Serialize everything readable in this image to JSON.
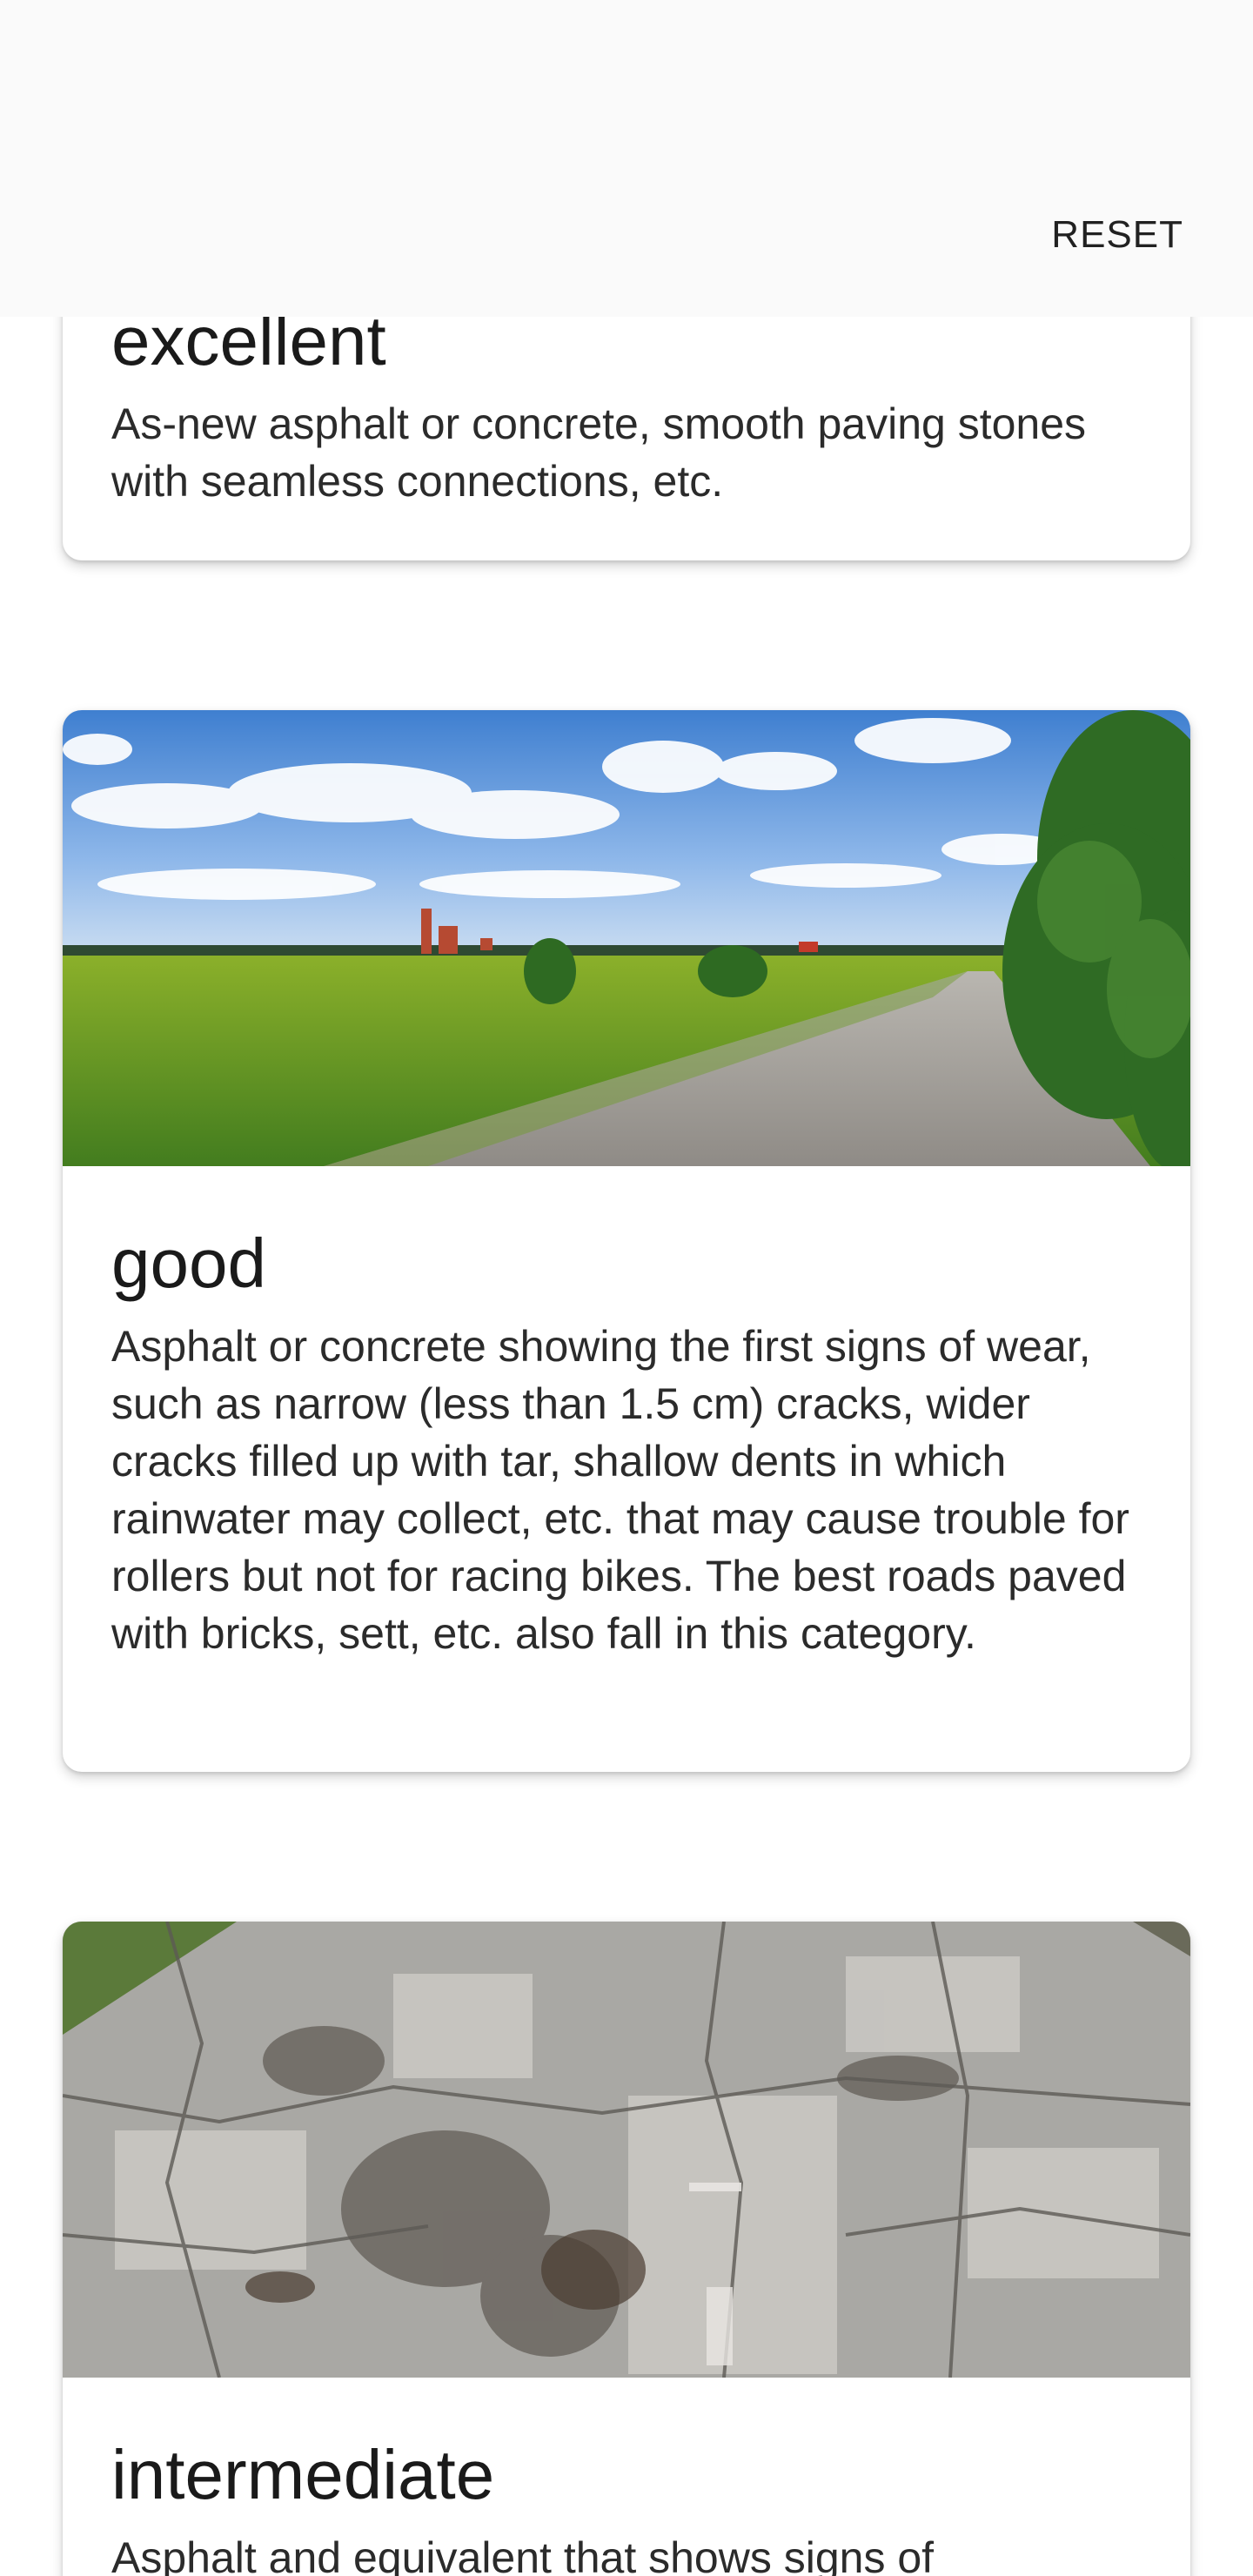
{
  "toolbar": {
    "reset_label": "RESET"
  },
  "cards": [
    {
      "title": "excellent",
      "description": "As-new asphalt or concrete, smooth paving stones with seamless connections, etc."
    },
    {
      "title": "good",
      "description": "Asphalt or concrete showing the first signs of wear, such as narrow (less than 1.5 cm) cracks, wider cracks filled up with tar, shallow dents in which rainwater may collect, etc. that may cause trouble for rollers but not for racing bikes. The best roads paved with bricks, sett, etc. also fall in this category.",
      "image": "road-through-green-field-photo"
    },
    {
      "title": "intermediate",
      "description": "Asphalt and equivalent that shows signs of",
      "image": "cracked-patched-asphalt-road-photo"
    }
  ]
}
